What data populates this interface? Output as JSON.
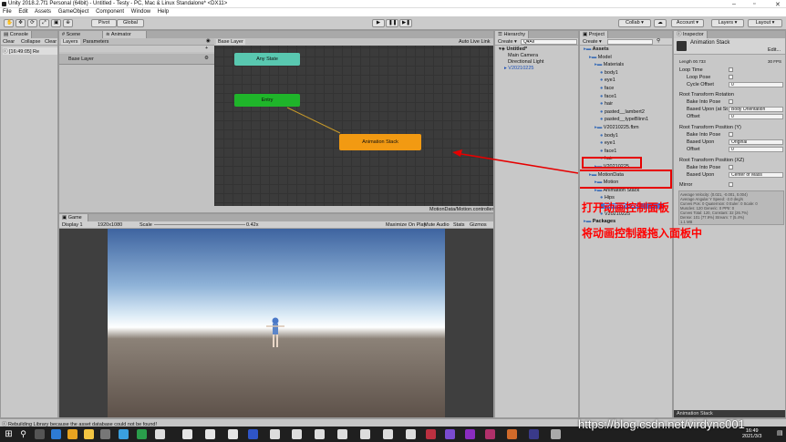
{
  "titlebar": {
    "title": "Unity 2018.2.7f1 Personal (64bit) - Untitled - Testy - PC, Mac & Linux Standalone* <DX11>"
  },
  "menu": [
    "File",
    "Edit",
    "Assets",
    "GameObject",
    "Component",
    "Window",
    "Help"
  ],
  "toolbar": {
    "pivot": "Pivot",
    "global": "Global",
    "collab": "Collab ▾",
    "account": "Account ▾",
    "layers": "Layers ▾",
    "layout": "Layout ▾"
  },
  "console": {
    "tab": "Console",
    "clear": "Clear",
    "collapse": "Collapse",
    "clear_on_play": "Clear",
    "log": "[16:49:05] Re"
  },
  "scene": {
    "tab": "Scene"
  },
  "animator": {
    "tab": "Animator",
    "layers_tab": "Layers",
    "parameters_tab": "Parameters",
    "base_layer": "Base Layer",
    "breadcrumb": "Base Layer",
    "auto_live": "Auto Live Link",
    "footer": "MotionData/Motion.controller",
    "any_state": "Any State",
    "entry": "Entry",
    "state": "Animation Stack"
  },
  "game": {
    "tab": "Game",
    "display": "Display 1",
    "resolution": "1920x1080",
    "scale_label": "Scale",
    "scale_value": "0.42x",
    "maximize": "Maximize On Play",
    "mute": "Mute Audio",
    "stats": "Stats",
    "gizmos": "Gizmos"
  },
  "hierarchy": {
    "tab": "Hierarchy",
    "create": "Create ▾",
    "search": "Q▾All",
    "scene": "Untitled*",
    "items": [
      "Main Camera",
      "Directional Light",
      "V20210225"
    ]
  },
  "project": {
    "tab": "Project",
    "create": "Create ▾",
    "items": [
      {
        "label": "Assets",
        "indent": 0,
        "bold": true
      },
      {
        "label": "Model",
        "indent": 1
      },
      {
        "label": "Materials",
        "indent": 2
      },
      {
        "label": "body1",
        "indent": 3
      },
      {
        "label": "eye1",
        "indent": 3
      },
      {
        "label": "face",
        "indent": 3
      },
      {
        "label": "face1",
        "indent": 3
      },
      {
        "label": "hair",
        "indent": 3
      },
      {
        "label": "pasted__lambert2",
        "indent": 3
      },
      {
        "label": "pasted__typeBlinn1",
        "indent": 3
      },
      {
        "label": "V20210225.fbm",
        "indent": 2
      },
      {
        "label": "body1",
        "indent": 3
      },
      {
        "label": "eye1",
        "indent": 3
      },
      {
        "label": "face1",
        "indent": 3
      },
      {
        "label": "hair",
        "indent": 3
      },
      {
        "label": "V20210225",
        "indent": 2
      },
      {
        "label": "MotionData",
        "indent": 1
      },
      {
        "label": "Motion",
        "indent": 2
      },
      {
        "label": "Animation Stack",
        "indent": 2
      },
      {
        "label": "Hips",
        "indent": 3
      },
      {
        "label": "Animation Stack",
        "indent": 3,
        "selected": true
      },
      {
        "label": "V20210225",
        "indent": 3
      },
      {
        "label": "Packages",
        "indent": 0,
        "bold": true
      }
    ]
  },
  "inspector": {
    "tab": "Inspector",
    "title": "Animation Stack",
    "edit": "Edit...",
    "length": "Length   00.733",
    "fps": "30 FPS",
    "loop_time": "Loop Time",
    "loop_pose": "Loop Pose",
    "cycle_offset": "Cycle Offset",
    "cycle_offset_value": "0",
    "root_rot": "Root Transform Rotation",
    "bake_pose": "Bake Into Pose",
    "based_upon_rot": "Based Upon (at St",
    "based_upon_rot_value": "Body Orientation",
    "offset": "Offset",
    "offset_value": "0",
    "root_y": "Root Transform Position (Y)",
    "bake_y": "Bake Into Pose",
    "based_upon_y": "Based Upon",
    "based_upon_y_value": "Original",
    "offset_y": "Offset",
    "offset_y_value": "0",
    "root_xz": "Root Transform Position (XZ)",
    "bake_xz": "Bake Into Pose",
    "based_upon_xz": "Based Upon",
    "based_upon_xz_value": "Center of Mass",
    "mirror": "Mirror",
    "stats": "Average Velocity: (0.021, -0.001, 0.004)\nAverage Angular Y Speed: -2.0 deg/s\nCurves Pos: 0 Quaternion: 0 Euler: 0 Scale: 0\nMuscles: 120 Generic: 0 PPtr: 0\nCurves Total: 120, Constant: 32 (26.7%)\nDense: 101 (77.9%) Stream: 7 (5.4%)\n1.1 MB",
    "preview": "Animation Stack"
  },
  "annotation": {
    "line1": "打开动画控制面板",
    "line2": "将动画控制器拖入面板中",
    "color": "#ff0000"
  },
  "statusbar": {
    "message": "Rebuilding Library because the asset database could not be found!"
  },
  "taskbar": {
    "clock_time": "16:49",
    "clock_date": "2021/3/3",
    "watermark": "https://blog.csdn.net/virdync001"
  }
}
